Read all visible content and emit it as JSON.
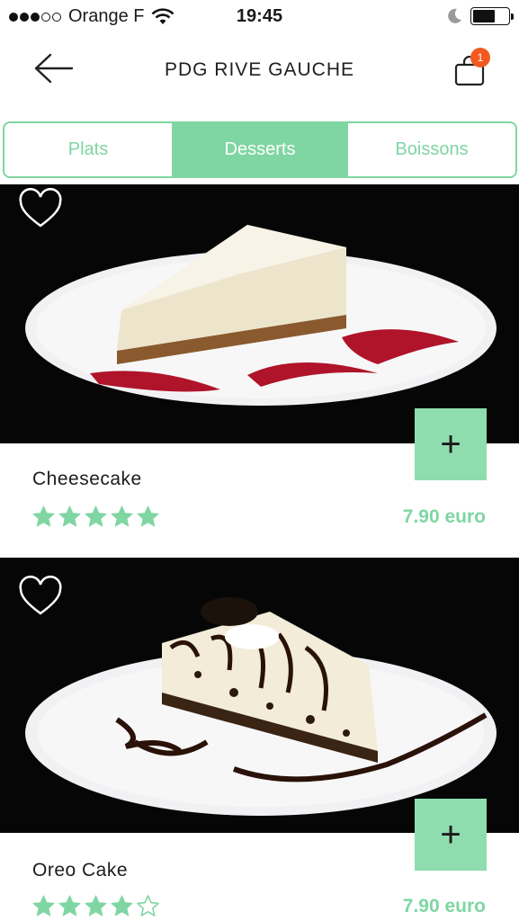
{
  "status_bar": {
    "carrier": "Orange F",
    "time": "19:45",
    "signal_bars_filled": 3,
    "signal_bars_total": 5
  },
  "header": {
    "title": "PDG RIVE GAUCHE",
    "cart_count": "1"
  },
  "tabs": [
    {
      "label": "Plats",
      "active": false
    },
    {
      "label": "Desserts",
      "active": true
    },
    {
      "label": "Boissons",
      "active": false
    }
  ],
  "products": [
    {
      "name": "Cheesecake",
      "price": "7.90 euro",
      "rating": 5,
      "rating_max": 5,
      "add_label": "+"
    },
    {
      "name": "Oreo Cake",
      "price": "7.90 euro",
      "rating": 4,
      "rating_max": 5,
      "add_label": "+"
    }
  ],
  "colors": {
    "accent": "#7fd6a2",
    "badge": "#f25a1f",
    "image_bg": "#060606"
  },
  "icons": {
    "back": "arrow-left-icon",
    "cart": "shopping-bag-icon",
    "favorite": "heart-outline-icon",
    "add": "plus-icon",
    "star_filled": "star-filled-icon",
    "star_empty": "star-outline-icon"
  }
}
